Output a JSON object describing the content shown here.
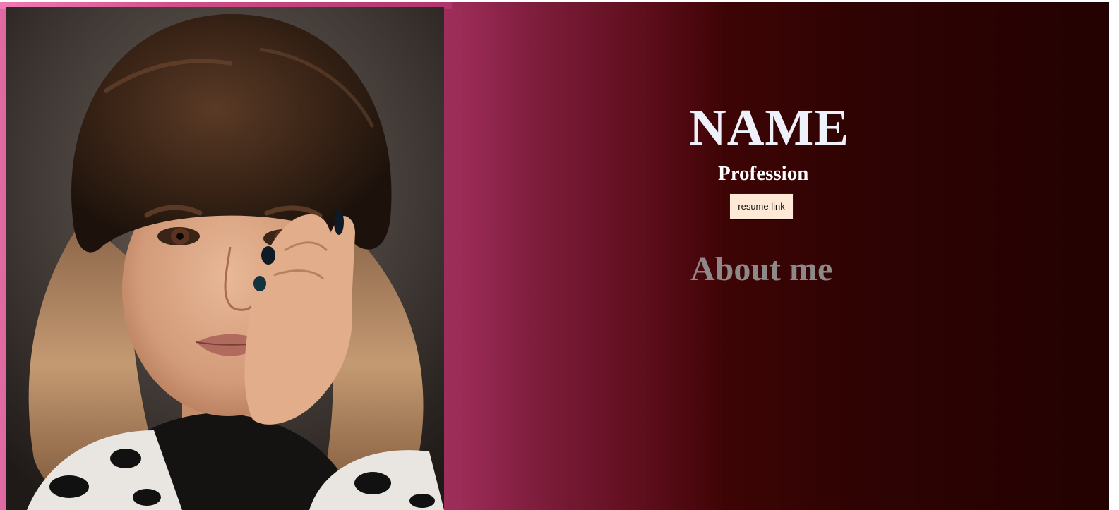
{
  "header": {
    "name": "NAME",
    "profession": "Profession"
  },
  "actions": {
    "resume_label": "resume link"
  },
  "sections": {
    "about_title": "About me"
  },
  "profile_image": {
    "alt": "profile photo"
  },
  "colors": {
    "gradient_start": "#e06aa3",
    "gradient_mid": "#9c2c58",
    "gradient_end": "#230202",
    "button_bg": "#fde9d6",
    "name_text": "#eef0fa",
    "about_text": "#8e8888"
  }
}
